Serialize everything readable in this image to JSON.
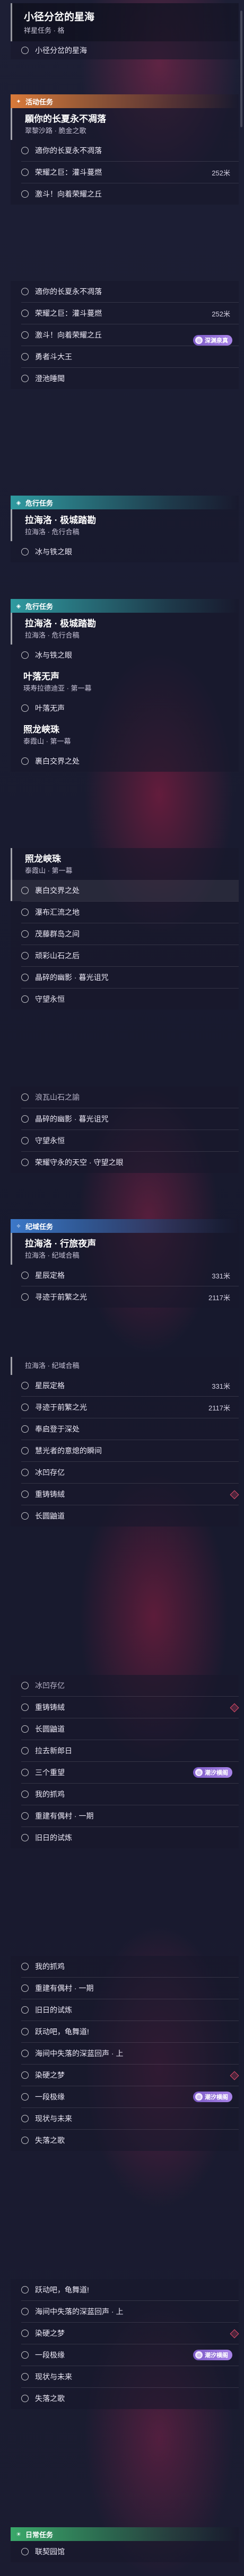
{
  "tracked": {
    "title": "小径分岔的星海",
    "subtitle": "祥星任务 · 格",
    "item": "小径分岔的星海"
  },
  "activity": {
    "category": "活动任务",
    "quest_title": "願你的长夏永不凋落",
    "quest_sub": "翠黎沙路 · 脆金之歌",
    "rows": [
      {
        "label": "適你的长夏永不凋落"
      },
      {
        "label": "荣耀之巨：灌斗蔓燃",
        "dist": "252米"
      },
      {
        "label": "激斗！向着荣耀之丘"
      }
    ]
  },
  "activity2": {
    "rows": [
      {
        "label": "適你的长夏永不凋落"
      },
      {
        "label": "荣耀之巨：灌斗蔓燃",
        "dist": "252米"
      },
      {
        "label": "激斗！向着荣耀之丘"
      },
      {
        "label": "勇者斗大王"
      },
      {
        "label": "澄池睡聞"
      }
    ],
    "chip": "深渊泉真"
  },
  "domain1": {
    "category": "危行任务",
    "quest_title": "拉海洛 · 极城踏勘",
    "quest_sub": "拉海洛 · 危行合稿",
    "rows": [
      {
        "label": "冰与铁之眼"
      }
    ]
  },
  "domain2": {
    "category": "危行任务",
    "quest_title": "拉海洛 · 极城踏勘",
    "quest_sub": "拉海洛 · 危行合稿",
    "rows": [
      {
        "label": "冰与铁之眼"
      }
    ],
    "quest2_title": "叶落无声",
    "quest2_sub": "瑛寿拉德迪亚 · 第一幕",
    "rows2": [
      {
        "label": "叶落无声"
      }
    ],
    "quest3_title": "照龙峡珠",
    "quest3_sub": "泰霞山 · 第一幕",
    "rows3": [
      {
        "label": "裹白交界之处"
      }
    ]
  },
  "domain3": {
    "quest_title": "照龙峡珠",
    "quest_sub": "泰霞山 · 第一幕",
    "rows": [
      {
        "label": "裹白交界之处"
      },
      {
        "label": "瀑布汇流之地"
      },
      {
        "label": "茂藤群岛之间"
      },
      {
        "label": "顽彩山石之后"
      },
      {
        "label": "晶碎的幽影 · 暮光诅咒"
      },
      {
        "label": "守望永恒"
      }
    ],
    "rows_b": [
      {
        "label": "浪瓦山石之諭"
      },
      {
        "label": "晶碎的幽影 · 暮光诅咒"
      },
      {
        "label": "守望永恒"
      },
      {
        "label": "荣耀守永的天空 · 守望之眼"
      }
    ]
  },
  "legend": {
    "category": "纪域任务",
    "quest_title": "拉海洛 · 行旅夜声",
    "quest_sub": "拉海洛 · 纪域合稿",
    "rows": [
      {
        "label": "星辰定格",
        "dist": "331米"
      },
      {
        "label": "寻迹于前繁之光",
        "dist": "2117米"
      }
    ],
    "quest_sub2": "拉海洛 · 纪域合稿",
    "rows2": [
      {
        "label": "星辰定格",
        "dist": "331米"
      },
      {
        "label": "寻迹于前繁之光",
        "dist": "2117米"
      },
      {
        "label": "奉启登于深处"
      },
      {
        "label": "慧光者的意熄的瞬间"
      },
      {
        "label": "冰凹存亿"
      },
      {
        "label": "重铸铸絨"
      },
      {
        "label": "长圆鼬道"
      }
    ]
  },
  "list5": {
    "rows": [
      {
        "label": "冰凹存亿"
      },
      {
        "label": "重铸铸絨"
      },
      {
        "label": "长圆鼬道"
      },
      {
        "label": "拉去新郎日"
      },
      {
        "label": "三个重望"
      },
      {
        "label": "我的抓鸡"
      },
      {
        "label": "重建有偶村 · 一期"
      },
      {
        "label": "旧日的试炼"
      }
    ],
    "chip": "潮汐横阁"
  },
  "list6": {
    "rows": [
      {
        "label": "我的抓鸡"
      },
      {
        "label": "重建有偶村 · 一期"
      },
      {
        "label": "旧日的试炼"
      },
      {
        "label": "跃动吧，龟舞道!"
      },
      {
        "label": "海间中失落的深蓝回声 · 上"
      },
      {
        "label": "染硬之梦"
      },
      {
        "label": "一段极缘"
      },
      {
        "label": "现状与未来"
      },
      {
        "label": "失落之歌"
      }
    ],
    "chip": "潮汐横阁"
  },
  "list7": {
    "rows": [
      {
        "label": "跃动吧，龟舞道!"
      },
      {
        "label": "海间中失落的深蓝回声 · 上"
      },
      {
        "label": "染硬之梦"
      },
      {
        "label": "一段极缘"
      },
      {
        "label": "现状与未来"
      },
      {
        "label": "失落之歌"
      }
    ],
    "chip": "潮汐横阁"
  },
  "daily": {
    "category": "日常任务",
    "rows": [
      {
        "label": "联契园馆"
      }
    ]
  }
}
